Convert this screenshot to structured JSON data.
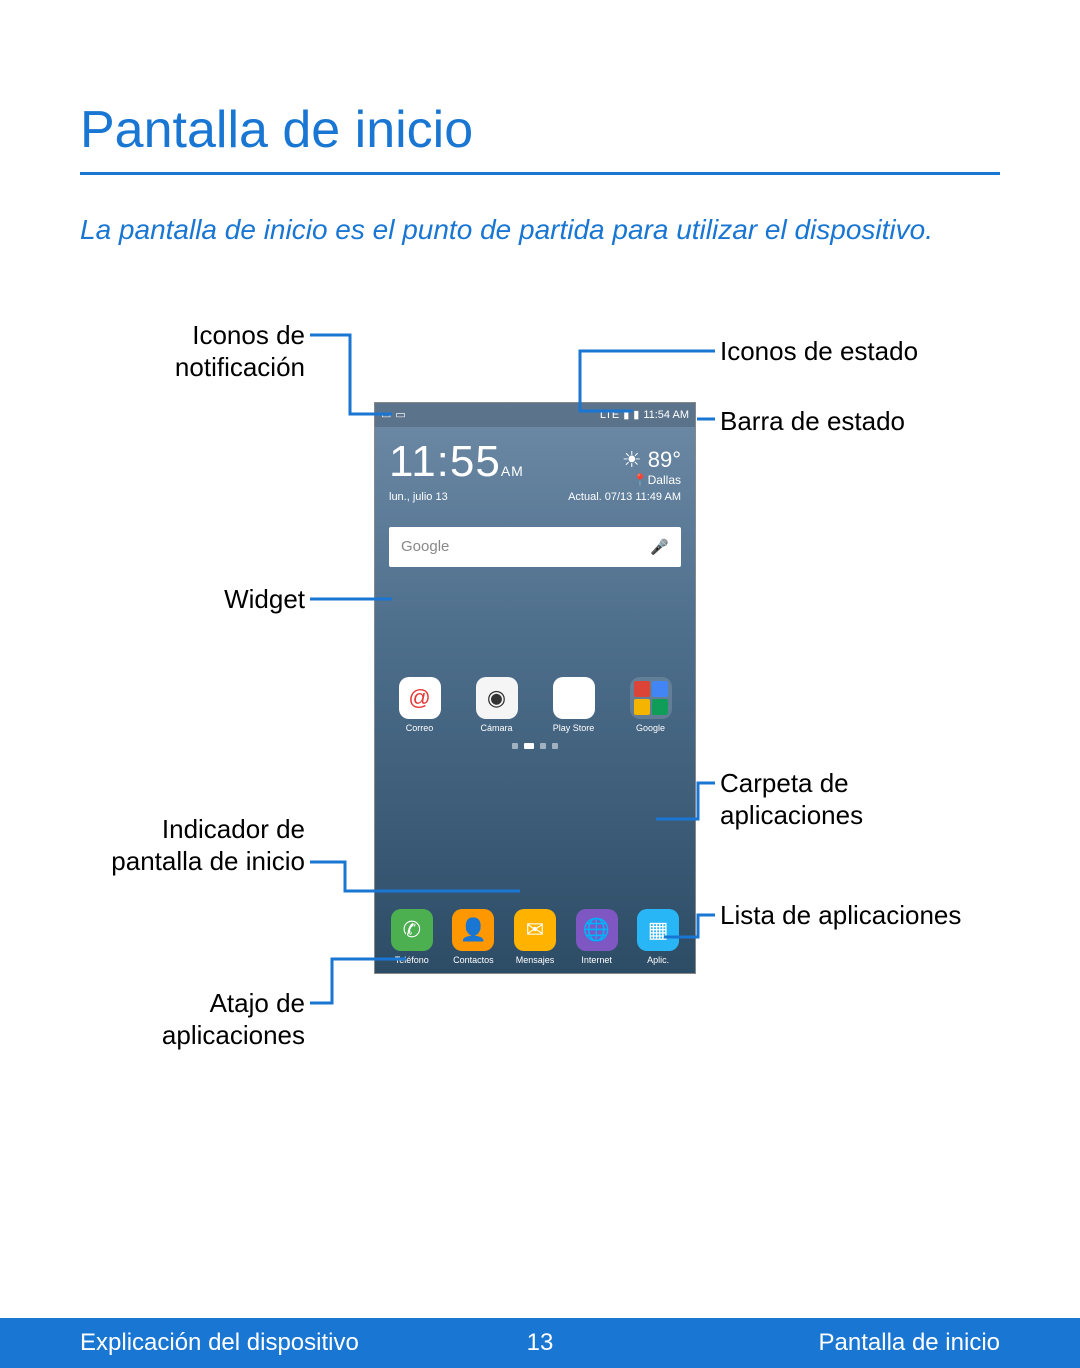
{
  "title": "Pantalla de inicio",
  "subtitle": "La pantalla de inicio es el punto de partida para utilizar el dispositivo.",
  "callouts": {
    "notification_icons": "Iconos de notificación",
    "status_icons": "Iconos de estado",
    "status_bar": "Barra de estado",
    "widget": "Widget",
    "app_folder": "Carpeta de aplicaciones",
    "home_indicator": "Indicador de pantalla de inicio",
    "apps_list": "Lista de aplicaciones",
    "app_shortcut": "Atajo de aplicaciones"
  },
  "phone": {
    "status_time": "11:54 AM",
    "lte": "LTE",
    "clock": {
      "time": "11:55",
      "ampm": "AM"
    },
    "weather": {
      "temp": "89°",
      "location": "Dallas",
      "icon": "☀"
    },
    "date": "lun., julio 13",
    "updated": "Actual. 07/13 11:49 AM",
    "search_placeholder": "Google",
    "apps_upper": [
      {
        "label": "Correo"
      },
      {
        "label": "Cámara"
      },
      {
        "label": "Play Store"
      },
      {
        "label": "Google"
      }
    ],
    "dock": [
      {
        "label": "Teléfono"
      },
      {
        "label": "Contactos"
      },
      {
        "label": "Mensajes"
      },
      {
        "label": "Internet"
      },
      {
        "label": "Aplic."
      }
    ]
  },
  "footer": {
    "left": "Explicación del dispositivo",
    "page": "13",
    "right": "Pantalla de inicio"
  }
}
